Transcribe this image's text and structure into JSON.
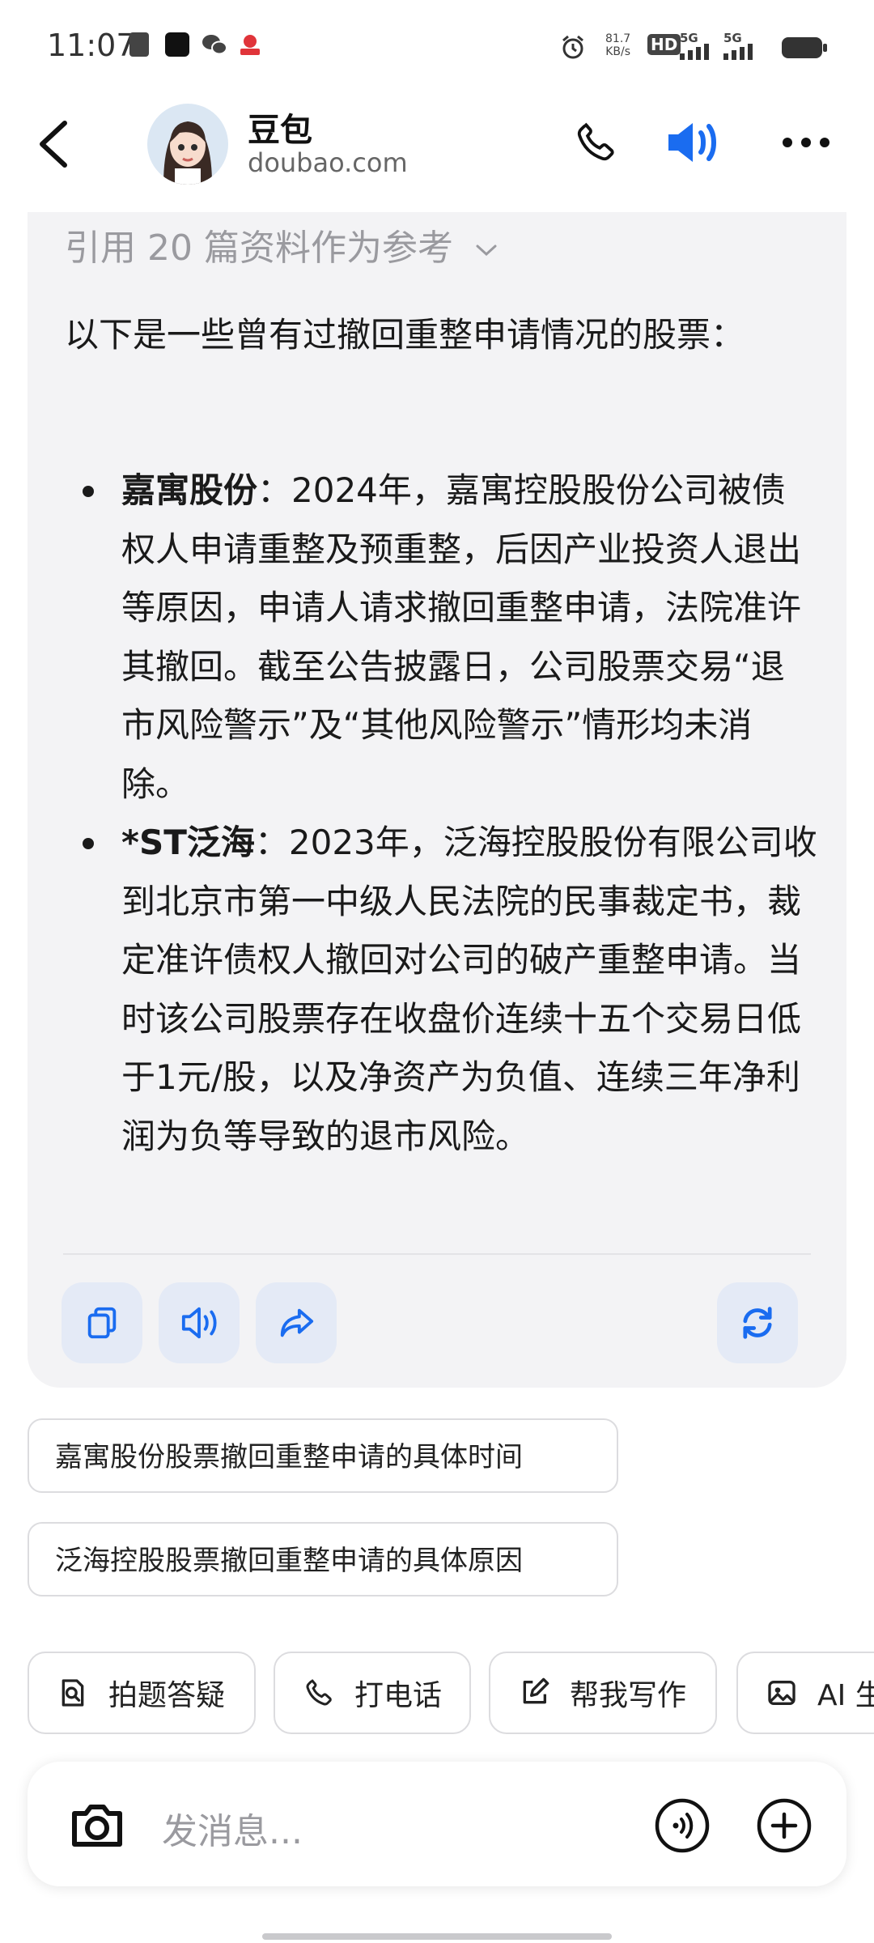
{
  "status_bar": {
    "time": "11:07",
    "net_speed_value": "81.7",
    "net_speed_unit": "KB/s",
    "hd_label": "HD",
    "sim1": "5G",
    "sim2": "5G"
  },
  "header": {
    "name": "豆包",
    "domain": "doubao.com",
    "icons": [
      "back-icon",
      "phone-icon",
      "speaker-icon",
      "more-icon"
    ]
  },
  "message": {
    "references_label": "引用 20 篇资料作为参考",
    "intro": "以下是一些曾有过撤回重整申请情况的股票：",
    "items": [
      {
        "title": "嘉寓股份",
        "body": "：2024年，嘉寓控股股份公司被债权人申请重整及预重整，后因产业投资人退出等原因，申请人请求撤回重整申请，法院准许其撤回。截至公告披露日，公司股票交易“退市风险警示”及“其他风险警示”情形均未消除。"
      },
      {
        "title": "*ST泛海",
        "body": "：2023年，泛海控股股份有限公司收到北京市第一中级人民法院的民事裁定书，裁定准许债权人撤回对公司的破产重整申请。当时该公司股票存在收盘价连续十五个交易日低于1元/股，以及净资产为负值、连续三年净利润为负等导致的退市风险。"
      }
    ],
    "actions": [
      "copy-icon",
      "read-aloud-icon",
      "share-icon",
      "regenerate-icon"
    ]
  },
  "suggestions": [
    "嘉寓股份股票撤回重整申请的具体时间",
    "泛海控股股票撤回重整申请的具体原因"
  ],
  "quick_actions": [
    {
      "label": "拍题答疑",
      "icon": "photo-question-icon"
    },
    {
      "label": "打电话",
      "icon": "phone-icon"
    },
    {
      "label": "帮我写作",
      "icon": "edit-icon"
    },
    {
      "label": "AI 生",
      "icon": "image-icon"
    }
  ],
  "input": {
    "placeholder": "发消息..."
  },
  "colors": {
    "accent": "#1a6cf0",
    "card_bg": "#f3f3f5",
    "action_bg": "#e4eaf6"
  }
}
